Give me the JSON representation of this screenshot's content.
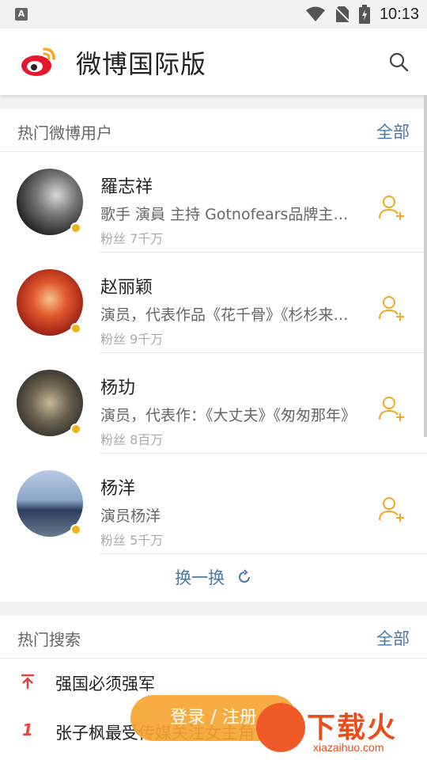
{
  "statusbar": {
    "time": "10:13",
    "app_icon_letter": "A"
  },
  "header": {
    "title": "微博国际版",
    "logo": "weibo-logo",
    "search_icon": "search-icon"
  },
  "users_section": {
    "title": "热门微博用户",
    "all_label": "全部",
    "users": [
      {
        "name": "羅志祥",
        "desc": "歌手 演員 主持 Gotnofears品牌主理人",
        "fans": "粉丝 7千万",
        "avatar_color": "#3a3a3a"
      },
      {
        "name": "赵丽颖",
        "desc": "演员，代表作品《花千骨》《杉杉来了》",
        "fans": "粉丝 9千万",
        "avatar_color": "#c0392b"
      },
      {
        "name": "杨玏",
        "desc": "演员，代表作：《大丈夫》《匆匆那年》",
        "fans": "粉丝 8百万",
        "avatar_color": "#5a5648"
      },
      {
        "name": "杨洋",
        "desc": "演员杨洋",
        "fans": "粉丝 5千万",
        "avatar_color": "#6f8fb5"
      }
    ],
    "refresh_label": "换一换"
  },
  "hot_section": {
    "title": "热门搜索",
    "all_label": "全部",
    "items": [
      {
        "rank": "↑",
        "text": "强国必须强军"
      },
      {
        "rank": "1",
        "text": "张子枫最受传媒关注女主角"
      }
    ]
  },
  "login_button": "登录 / 注册",
  "watermark": {
    "title": "下载火",
    "url": "xiazaihuo.com"
  },
  "colors": {
    "accent_blue": "#4a78a8",
    "orange": "#f7a533",
    "rank_red": "#e2453c"
  }
}
